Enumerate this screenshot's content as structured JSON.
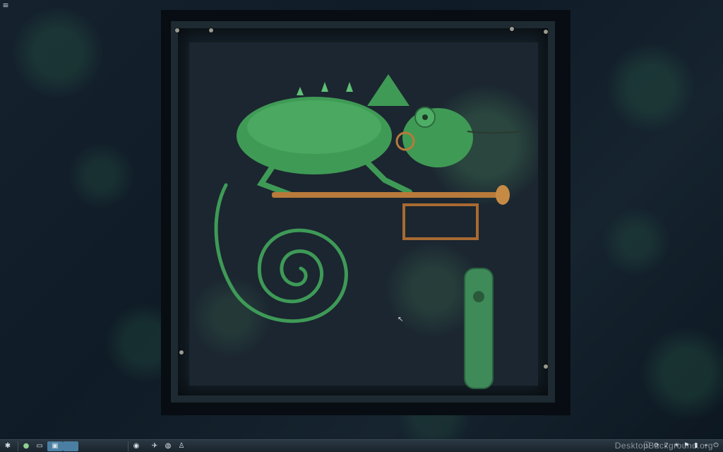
{
  "desktop": {
    "menu_icon": "hamburger-menu-icon",
    "cursor_icon": "mouse-pointer-icon",
    "wallpaper": {
      "subject": "steampunk-chameleon-artwork",
      "colors": {
        "background": "#0d1a24",
        "chameleon": "#3f9a55",
        "brass": "#b87a3a"
      }
    }
  },
  "taskbar": {
    "launchers": [
      {
        "icon": "start-menu-icon"
      },
      {
        "icon": "mint-logo-icon"
      },
      {
        "icon": "file-manager-icon"
      },
      {
        "icon": "workspace-1-icon"
      },
      {
        "icon": "workspace-2-icon"
      }
    ],
    "tasks": [
      {
        "icon": "disc-icon"
      },
      {
        "icon": "network-app-icon"
      },
      {
        "icon": "browser-icon"
      },
      {
        "icon": "user-app-icon"
      }
    ],
    "tray": [
      {
        "icon": "info-icon"
      },
      {
        "icon": "sync-icon"
      },
      {
        "icon": "volume-icon"
      },
      {
        "icon": "weather-icon"
      },
      {
        "icon": "flag-icon"
      },
      {
        "icon": "battery-icon"
      },
      {
        "icon": "network-icon"
      },
      {
        "icon": "power-icon"
      }
    ],
    "active_color": "#4a7fa3"
  },
  "watermark": "DesktopBackground.org"
}
